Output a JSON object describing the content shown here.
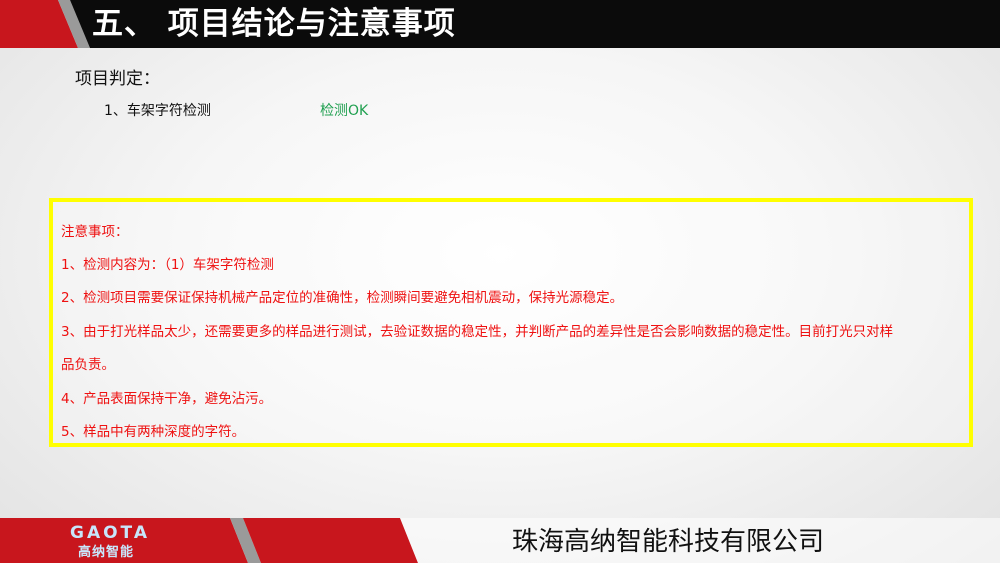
{
  "header": {
    "title": "五、 项目结论与注意事项"
  },
  "verdict": {
    "heading": "项目判定：",
    "item": "1、车架字符检测",
    "result": "检测OK"
  },
  "notes": {
    "heading": "注意事项：",
    "lines": [
      "1、检测内容为：（1）车架字符检测",
      "2、检测项目需要保证保持机械产品定位的准确性，检测瞬间要避免相机震动，保持光源稳定。",
      "3、由于打光样品太少，还需要更多的样品进行测试，去验证数据的稳定性，并判断产品的差异性是否会影响数据的稳定性。目前打光只对样",
      "品负责。",
      "4、产品表面保持干净，避免沾污。",
      "5、样品中有两种深度的字符。"
    ]
  },
  "footer": {
    "logo_text": "GAOTA",
    "logo_cn": "高纳智能",
    "company": "珠海高纳智能科技有限公司"
  },
  "colors": {
    "header_red": "#c8161d",
    "header_black": "#0b0b0b",
    "note_red": "#ee1111",
    "ok_green": "#20a050",
    "highlight_yellow": "#ffff00"
  }
}
